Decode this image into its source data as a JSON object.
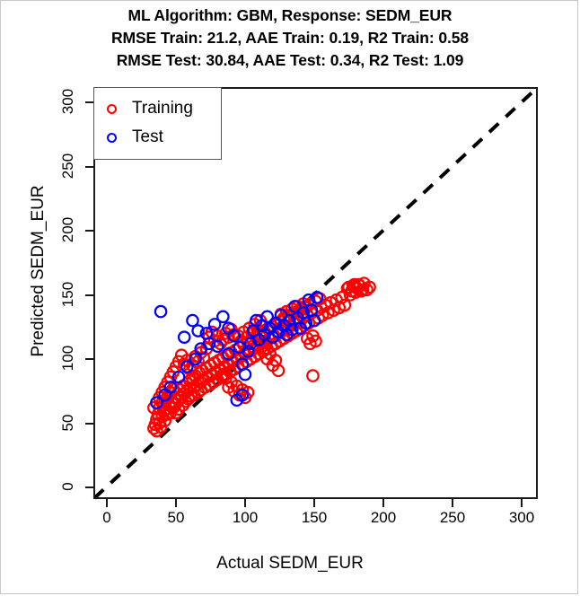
{
  "title": {
    "line1": "ML Algorithm: GBM, Response: SEDM_EUR",
    "line2": "RMSE Train: 21.2, AAE Train: 0.19, R2 Train: 0.58",
    "line3": "RMSE Test: 30.84, AAE Test: 0.34, R2 Test: 1.09"
  },
  "legend": {
    "training_label": "Training",
    "test_label": "Test",
    "training_color": "#ff0000",
    "test_color": "#0000ff"
  },
  "chart_data": {
    "type": "scatter",
    "title": "ML Algorithm: GBM, Response: SEDM_EUR",
    "subtitle": "RMSE Train: 21.2, AAE Train: 0.19, R2 Train: 0.58 / RMSE Test: 30.84, AAE Test: 0.34, R2 Test: 1.09",
    "xlabel": "Actual SEDM_EUR",
    "ylabel": "Predicted SEDM_EUR",
    "xlim": [
      -5,
      310
    ],
    "ylim": [
      -8,
      312
    ],
    "xticks": [
      0,
      50,
      100,
      150,
      200,
      250,
      300
    ],
    "yticks": [
      0,
      50,
      100,
      150,
      200,
      250,
      300
    ],
    "grid": false,
    "legend_position": "top-left",
    "marker": "open-circle",
    "metrics": {
      "rmse_train": 21.2,
      "aae_train": 0.19,
      "r2_train": 0.58,
      "rmse_test": 30.84,
      "aae_test": 0.34,
      "r2_test": 1.09
    },
    "reference_line": {
      "label": "1:1 line",
      "style": "dashed",
      "color": "#000000",
      "from": [
        0,
        0
      ],
      "to": [
        310,
        310
      ]
    },
    "series": [
      {
        "name": "Training",
        "color": "#ff0000",
        "points": [
          [
            34,
            46
          ],
          [
            35,
            49
          ],
          [
            36,
            53
          ],
          [
            36,
            44
          ],
          [
            37,
            57
          ],
          [
            38,
            50
          ],
          [
            38,
            62
          ],
          [
            39,
            47
          ],
          [
            40,
            55
          ],
          [
            40,
            66
          ],
          [
            41,
            59
          ],
          [
            42,
            52
          ],
          [
            42,
            68
          ],
          [
            43,
            61
          ],
          [
            44,
            57
          ],
          [
            44,
            71
          ],
          [
            45,
            64
          ],
          [
            46,
            58
          ],
          [
            46,
            74
          ],
          [
            47,
            67
          ],
          [
            48,
            62
          ],
          [
            48,
            77
          ],
          [
            49,
            70
          ],
          [
            50,
            65
          ],
          [
            50,
            58
          ],
          [
            51,
            73
          ],
          [
            52,
            68
          ],
          [
            52,
            61
          ],
          [
            53,
            76
          ],
          [
            54,
            70
          ],
          [
            55,
            64
          ],
          [
            55,
            79
          ],
          [
            56,
            73
          ],
          [
            57,
            67
          ],
          [
            58,
            81
          ],
          [
            58,
            75
          ],
          [
            59,
            69
          ],
          [
            60,
            83
          ],
          [
            60,
            77
          ],
          [
            61,
            71
          ],
          [
            62,
            85
          ],
          [
            63,
            78
          ],
          [
            63,
            72
          ],
          [
            64,
            87
          ],
          [
            65,
            80
          ],
          [
            66,
            74
          ],
          [
            67,
            89
          ],
          [
            68,
            82
          ],
          [
            68,
            76
          ],
          [
            69,
            91
          ],
          [
            70,
            84
          ],
          [
            71,
            78
          ],
          [
            72,
            93
          ],
          [
            73,
            86
          ],
          [
            74,
            80
          ],
          [
            75,
            95
          ],
          [
            76,
            88
          ],
          [
            77,
            82
          ],
          [
            78,
            97
          ],
          [
            79,
            90
          ],
          [
            80,
            84
          ],
          [
            81,
            99
          ],
          [
            82,
            92
          ],
          [
            83,
            86
          ],
          [
            84,
            101
          ],
          [
            85,
            94
          ],
          [
            86,
            88
          ],
          [
            87,
            103
          ],
          [
            88,
            96
          ],
          [
            89,
            90
          ],
          [
            90,
            105
          ],
          [
            91,
            98
          ],
          [
            92,
            92
          ],
          [
            93,
            107
          ],
          [
            94,
            100
          ],
          [
            95,
            94
          ],
          [
            96,
            109
          ],
          [
            97,
            102
          ],
          [
            98,
            96
          ],
          [
            99,
            111
          ],
          [
            100,
            104
          ],
          [
            101,
            98
          ],
          [
            102,
            113
          ],
          [
            103,
            106
          ],
          [
            104,
            100
          ],
          [
            105,
            115
          ],
          [
            106,
            108
          ],
          [
            107,
            102
          ],
          [
            108,
            117
          ],
          [
            109,
            110
          ],
          [
            110,
            104
          ],
          [
            111,
            119
          ],
          [
            112,
            112
          ],
          [
            113,
            106
          ],
          [
            114,
            121
          ],
          [
            115,
            114
          ],
          [
            116,
            108
          ],
          [
            117,
            123
          ],
          [
            118,
            116
          ],
          [
            119,
            110
          ],
          [
            120,
            125
          ],
          [
            121,
            118
          ],
          [
            122,
            112
          ],
          [
            123,
            127
          ],
          [
            124,
            120
          ],
          [
            125,
            114
          ],
          [
            126,
            129
          ],
          [
            127,
            122
          ],
          [
            128,
            116
          ],
          [
            129,
            131
          ],
          [
            130,
            124
          ],
          [
            131,
            118
          ],
          [
            132,
            133
          ],
          [
            133,
            126
          ],
          [
            134,
            120
          ],
          [
            135,
            135
          ],
          [
            136,
            128
          ],
          [
            137,
            122
          ],
          [
            138,
            137
          ],
          [
            139,
            130
          ],
          [
            140,
            124
          ],
          [
            141,
            139
          ],
          [
            142,
            132
          ],
          [
            143,
            126
          ],
          [
            144,
            141
          ],
          [
            145,
            134
          ],
          [
            146,
            128
          ],
          [
            147,
            143
          ],
          [
            148,
            136
          ],
          [
            149,
            87
          ],
          [
            150,
            130
          ],
          [
            151,
            145
          ],
          [
            152,
            138
          ],
          [
            153,
            132
          ],
          [
            154,
            147
          ],
          [
            155,
            140
          ],
          [
            156,
            134
          ],
          [
            158,
            142
          ],
          [
            160,
            136
          ],
          [
            162,
            144
          ],
          [
            164,
            138
          ],
          [
            166,
            146
          ],
          [
            168,
            140
          ],
          [
            170,
            148
          ],
          [
            172,
            142
          ],
          [
            174,
            155
          ],
          [
            176,
            150
          ],
          [
            178,
            157
          ],
          [
            180,
            152
          ],
          [
            182,
            158
          ],
          [
            184,
            153
          ],
          [
            186,
            159
          ],
          [
            188,
            154
          ],
          [
            190,
            156
          ],
          [
            175,
            156
          ],
          [
            177,
            153
          ],
          [
            179,
            158
          ],
          [
            181,
            155
          ],
          [
            183,
            157
          ],
          [
            185,
            154
          ],
          [
            126,
            135
          ],
          [
            128,
            132
          ],
          [
            130,
            137
          ],
          [
            132,
            134
          ],
          [
            134,
            139
          ],
          [
            136,
            136
          ],
          [
            138,
            141
          ],
          [
            140,
            138
          ],
          [
            142,
            143
          ],
          [
            144,
            140
          ],
          [
            145,
            116
          ],
          [
            147,
            112
          ],
          [
            149,
            118
          ],
          [
            151,
            114
          ],
          [
            120,
            95
          ],
          [
            122,
            99
          ],
          [
            124,
            91
          ],
          [
            118,
            104
          ],
          [
            116,
            100
          ],
          [
            114,
            108
          ],
          [
            95,
            118
          ],
          [
            97,
            114
          ],
          [
            99,
            121
          ],
          [
            101,
            117
          ],
          [
            103,
            124
          ],
          [
            105,
            120
          ],
          [
            107,
            127
          ],
          [
            109,
            123
          ],
          [
            111,
            130
          ],
          [
            113,
            126
          ],
          [
            86,
            120
          ],
          [
            88,
            117
          ],
          [
            90,
            123
          ],
          [
            92,
            119
          ],
          [
            84,
            115
          ],
          [
            82,
            112
          ],
          [
            80,
            118
          ],
          [
            78,
            114
          ],
          [
            76,
            121
          ],
          [
            74,
            117
          ],
          [
            64,
            102
          ],
          [
            66,
            98
          ],
          [
            68,
            105
          ],
          [
            70,
            101
          ],
          [
            72,
            108
          ],
          [
            62,
            95
          ],
          [
            60,
            92
          ],
          [
            58,
            99
          ],
          [
            56,
            96
          ],
          [
            54,
            103
          ],
          [
            38,
            70
          ],
          [
            40,
            74
          ],
          [
            42,
            78
          ],
          [
            44,
            82
          ],
          [
            46,
            86
          ],
          [
            36,
            66
          ],
          [
            34,
            62
          ],
          [
            48,
            90
          ],
          [
            50,
            94
          ],
          [
            52,
            98
          ],
          [
            92,
            75
          ],
          [
            94,
            79
          ],
          [
            96,
            72
          ],
          [
            98,
            76
          ],
          [
            100,
            70
          ],
          [
            102,
            74
          ],
          [
            88,
            78
          ],
          [
            90,
            82
          ],
          [
            86,
            85
          ],
          [
            84,
            88
          ]
        ]
      },
      {
        "name": "Test",
        "color": "#0000ff",
        "points": [
          [
            39,
            137
          ],
          [
            56,
            117
          ],
          [
            62,
            130
          ],
          [
            66,
            122
          ],
          [
            72,
            120
          ],
          [
            78,
            127
          ],
          [
            84,
            133
          ],
          [
            88,
            124
          ],
          [
            92,
            118
          ],
          [
            96,
            109
          ],
          [
            98,
            96
          ],
          [
            100,
            88
          ],
          [
            102,
            106
          ],
          [
            106,
            122
          ],
          [
            108,
            130
          ],
          [
            110,
            115
          ],
          [
            112,
            126
          ],
          [
            114,
            119
          ],
          [
            116,
            133
          ],
          [
            118,
            124
          ],
          [
            120,
            117
          ],
          [
            122,
            128
          ],
          [
            124,
            121
          ],
          [
            126,
            134
          ],
          [
            128,
            126
          ],
          [
            130,
            119
          ],
          [
            132,
            130
          ],
          [
            134,
            123
          ],
          [
            136,
            141
          ],
          [
            138,
            132
          ],
          [
            140,
            124
          ],
          [
            142,
            136
          ],
          [
            144,
            128
          ],
          [
            146,
            146
          ],
          [
            148,
            138
          ],
          [
            150,
            130
          ],
          [
            152,
            148
          ],
          [
            88,
            104
          ],
          [
            80,
            110
          ],
          [
            74,
            112
          ],
          [
            68,
            108
          ],
          [
            64,
            100
          ],
          [
            58,
            94
          ],
          [
            52,
            86
          ],
          [
            46,
            78
          ],
          [
            42,
            72
          ],
          [
            36,
            66
          ],
          [
            94,
            68
          ],
          [
            98,
            72
          ],
          [
            104,
            112
          ]
        ]
      }
    ]
  },
  "axes": {
    "xlabel": "Actual SEDM_EUR",
    "ylabel": "Predicted SEDM_EUR",
    "xticks": [
      "0",
      "50",
      "100",
      "150",
      "200",
      "250",
      "300"
    ],
    "yticks": [
      "0",
      "50",
      "100",
      "150",
      "200",
      "250",
      "300"
    ]
  }
}
